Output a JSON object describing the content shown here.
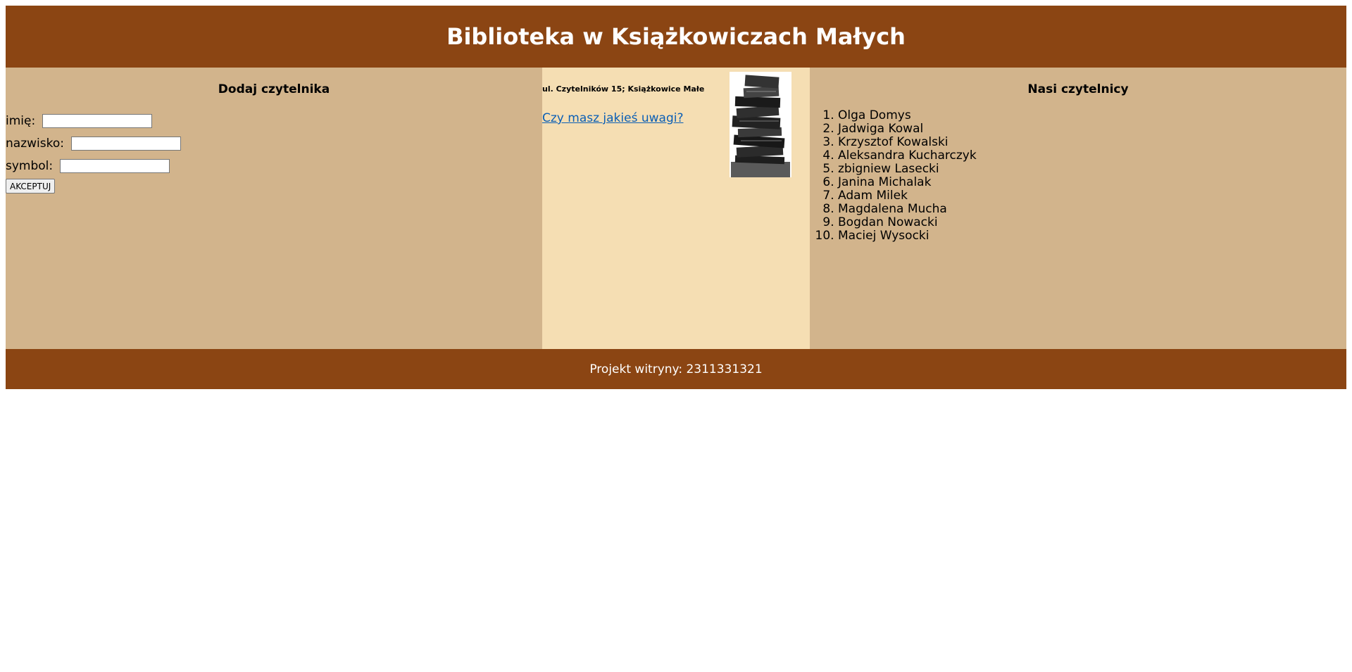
{
  "header": {
    "title": "Biblioteka w Książkowiczach Małych"
  },
  "left": {
    "title": "Dodaj czytelnika",
    "fields": [
      {
        "label": "imię:",
        "value": ""
      },
      {
        "label": "nazwisko:",
        "value": ""
      },
      {
        "label": "symbol:",
        "value": ""
      }
    ],
    "submit_label": "AKCEPTUJ"
  },
  "middle": {
    "address": "ul. Czytelników 15; Książkowice Małe",
    "link_text": "Czy masz jakieś uwagi?",
    "image_icon": "book-stack-image"
  },
  "right": {
    "title": "Nasi czytelnicy",
    "readers": [
      "Olga Domys",
      "Jadwiga Kowal",
      "Krzysztof Kowalski",
      "Aleksandra Kucharczyk",
      "zbigniew Lasecki",
      "Janina Michalak",
      "Adam Milek",
      "Magdalena Mucha",
      "Bogdan Nowacki",
      "Maciej Wysocki"
    ]
  },
  "footer": {
    "text": "Projekt witryny: 2311331321"
  },
  "colors": {
    "brand_brown": "#8B4513",
    "tan": "#D2B48C",
    "wheat": "#F5DEB3",
    "link": "#0b5fb5"
  }
}
